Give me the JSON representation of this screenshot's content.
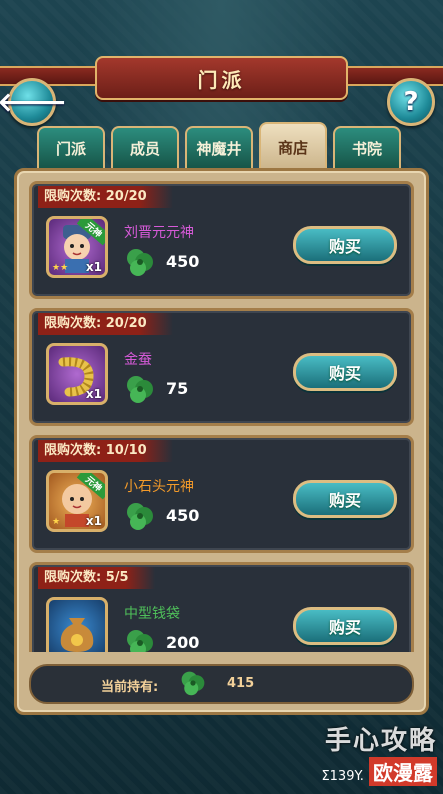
{
  "header": {
    "title": "门派"
  },
  "buttons": {
    "back_icon": "🡐",
    "help_icon": "?"
  },
  "tabs": [
    {
      "label": "门派",
      "active": false
    },
    {
      "label": "成员",
      "active": false
    },
    {
      "label": "神魔井",
      "active": false
    },
    {
      "label": "商店",
      "active": true
    },
    {
      "label": "书院",
      "active": false
    }
  ],
  "shop": {
    "items": [
      {
        "limit": "限购次数: 20/20",
        "name": "刘晋元元神",
        "price": "450",
        "qty": "x1",
        "tag": "元神",
        "stars": "★★",
        "buy_label": "购买",
        "name_color": "#d65ad8"
      },
      {
        "limit": "限购次数: 20/20",
        "name": "金蚕",
        "price": "75",
        "qty": "x1",
        "tag": "",
        "stars": "",
        "buy_label": "购买",
        "name_color": "#d65ad8"
      },
      {
        "limit": "限购次数: 10/10",
        "name": "小石头元神",
        "price": "450",
        "qty": "x1",
        "tag": "元神",
        "stars": "★",
        "buy_label": "购买",
        "name_color": "#f39a2a"
      },
      {
        "limit": "限购次数: 5/5",
        "name": "中型钱袋",
        "price": "200",
        "qty": "",
        "tag": "",
        "stars": "",
        "buy_label": "购买",
        "name_color": "#4fbf5a"
      }
    ]
  },
  "holding": {
    "label": "当前持有:",
    "value": "415"
  },
  "watermark": {
    "main": "手心攻略",
    "sub": "Σ139Y.",
    "badge": "欧漫露"
  },
  "colors": {
    "accent": "#d9b577",
    "tab_active": "#eedfbf",
    "buy_button": "#2c9aa4"
  }
}
